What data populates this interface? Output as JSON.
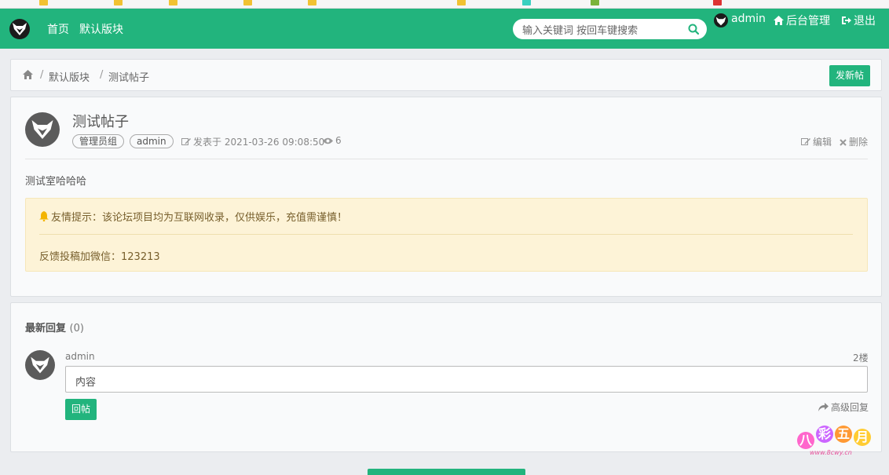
{
  "header": {
    "nav_home": "首页",
    "nav_board": "默认版块",
    "search_placeholder": "输入关键词 按回车键搜索",
    "username": "admin",
    "admin_link": "后台管理",
    "logout_link": "退出"
  },
  "breadcrumb": {
    "sep": "/",
    "board": "默认版块",
    "post": "测试帖子",
    "new_post_button": "发新帖"
  },
  "post": {
    "title": "测试帖子",
    "tags": [
      "管理员组",
      "admin"
    ],
    "posted_at": "发表于 2021-03-26 09:08:50",
    "views": "6",
    "edit_link": "编辑",
    "delete_link": "删除",
    "body": "测试室哈哈哈",
    "notice_line1": "友情提示：该论坛项目均为互联网收录，仅供娱乐，充值需谨慎！",
    "notice_line2": "反馈投稿加微信：123213"
  },
  "reply": {
    "title": "最新回复",
    "count": "(0)",
    "user": "admin",
    "floor": "2楼",
    "input_value": "内容",
    "submit_button": "回帖",
    "advanced_link": "高级回复"
  },
  "watermark": {
    "chars": [
      "八",
      "彩",
      "五",
      "月"
    ],
    "url": "www.8cwy.cn"
  },
  "colors": {
    "brand": "#22b47d",
    "notice_bg": "#fdf3d7",
    "notice_text": "#775f2c"
  }
}
